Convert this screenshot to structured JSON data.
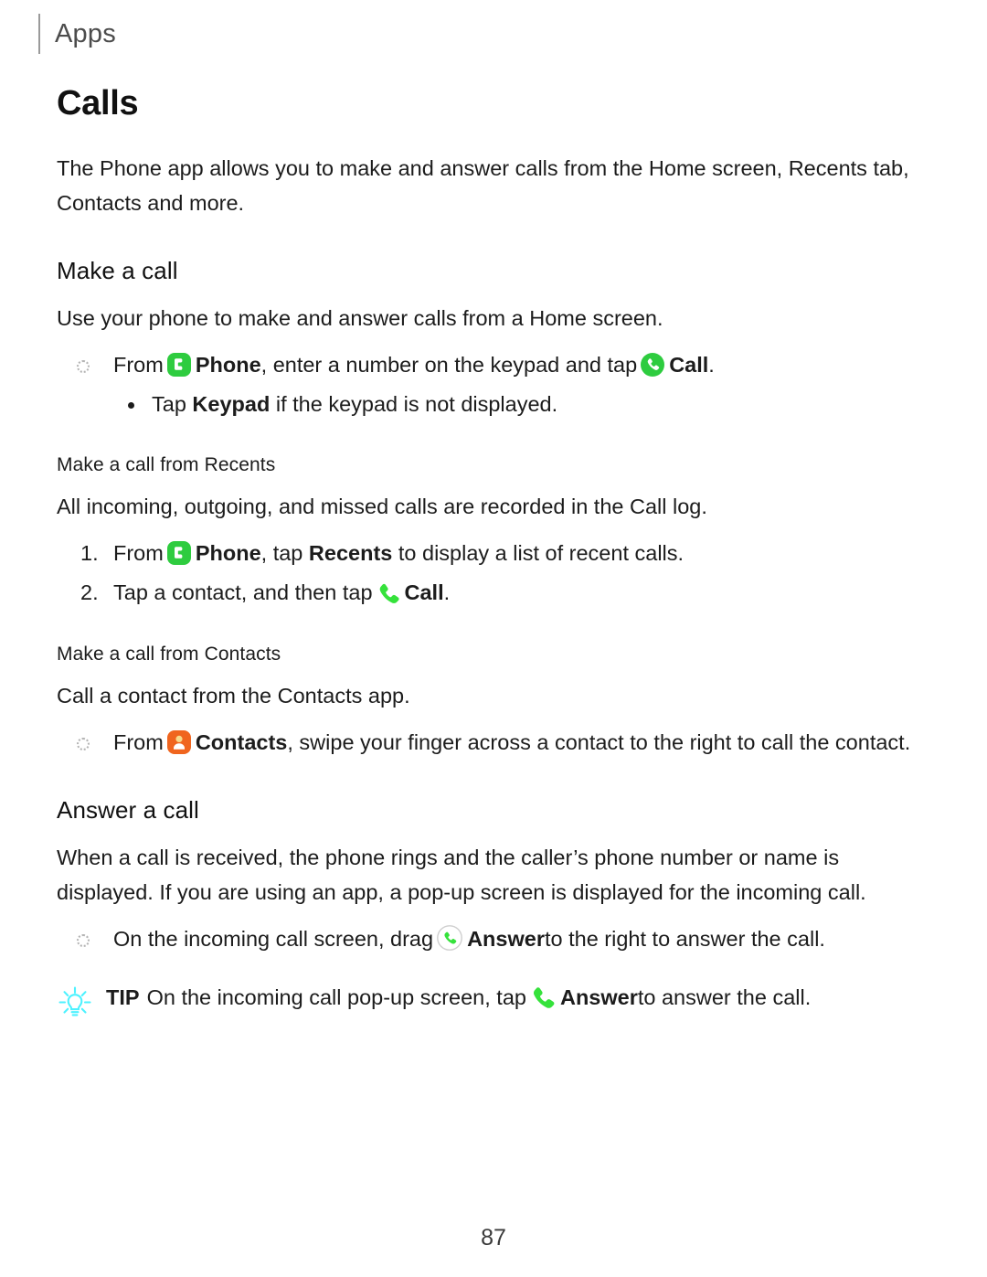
{
  "header": {
    "running_title": "Apps"
  },
  "chapter": {
    "title": "Calls",
    "intro": "The Phone app allows you to make and answer calls from the Home screen, Recents tab, Contacts and more."
  },
  "sections": {
    "make_a_call": {
      "heading": "Make a call",
      "intro": "Use your phone to make and answer calls from a Home screen.",
      "bullet": {
        "part1": "From",
        "phone_label": "Phone",
        "part2": ", enter a number on the keypad and tap",
        "call_label": "Call",
        "part3": "."
      },
      "sub_bullet": {
        "part1": "Tap",
        "keypad_label": "Keypad",
        "part2": "if the keypad is not displayed."
      }
    },
    "from_recents": {
      "heading": "Make a call from Recents",
      "intro": "All incoming, outgoing, and missed calls are recorded in the Call log.",
      "steps": [
        {
          "number": "1.",
          "part1": "From",
          "phone_label": "Phone",
          "part2": ", tap",
          "recents_label": "Recents",
          "part3": "to display a list of recent calls."
        },
        {
          "number": "2.",
          "part1": "Tap a contact, and then tap",
          "call_label": "Call",
          "part2": "."
        }
      ]
    },
    "from_contacts": {
      "heading": "Make a call from Contacts",
      "intro": "Call a contact from the Contacts app.",
      "bullet": {
        "part1": "From",
        "contacts_label": "Contacts",
        "part2": ", swipe your finger across a contact to the right to call the contact."
      }
    },
    "answer_a_call": {
      "heading": "Answer a call",
      "intro": "When a call is received, the phone rings and the caller’s phone number or name is displayed. If you are using an app, a pop-up screen is displayed for the incoming call.",
      "bullet": {
        "part1": "On the incoming call screen, drag",
        "answer_label": "Answer",
        "part2": "to the right to answer the call."
      },
      "tip": {
        "label": "TIP",
        "part1": "On the incoming call pop-up screen, tap",
        "answer_label": "Answer",
        "part2": "to answer the call."
      }
    }
  },
  "footer": {
    "page_number": "87"
  },
  "icons": {
    "phone_app": "phone-app-icon",
    "call_circle": "call-icon",
    "call_handset": "call-handset-icon",
    "contacts_app": "contacts-app-icon",
    "answer_outline": "answer-icon",
    "tip_bulb": "lightbulb-icon"
  },
  "colors": {
    "phone_green": "#2ecc3f",
    "handset_green": "#35e23b",
    "contacts_orange": "#f0651e",
    "contacts_head": "#f7d98a",
    "tip_cyan": "#4df2ff",
    "header_gray": "#4c4c4c",
    "rule_gray": "#9a9a9a"
  }
}
